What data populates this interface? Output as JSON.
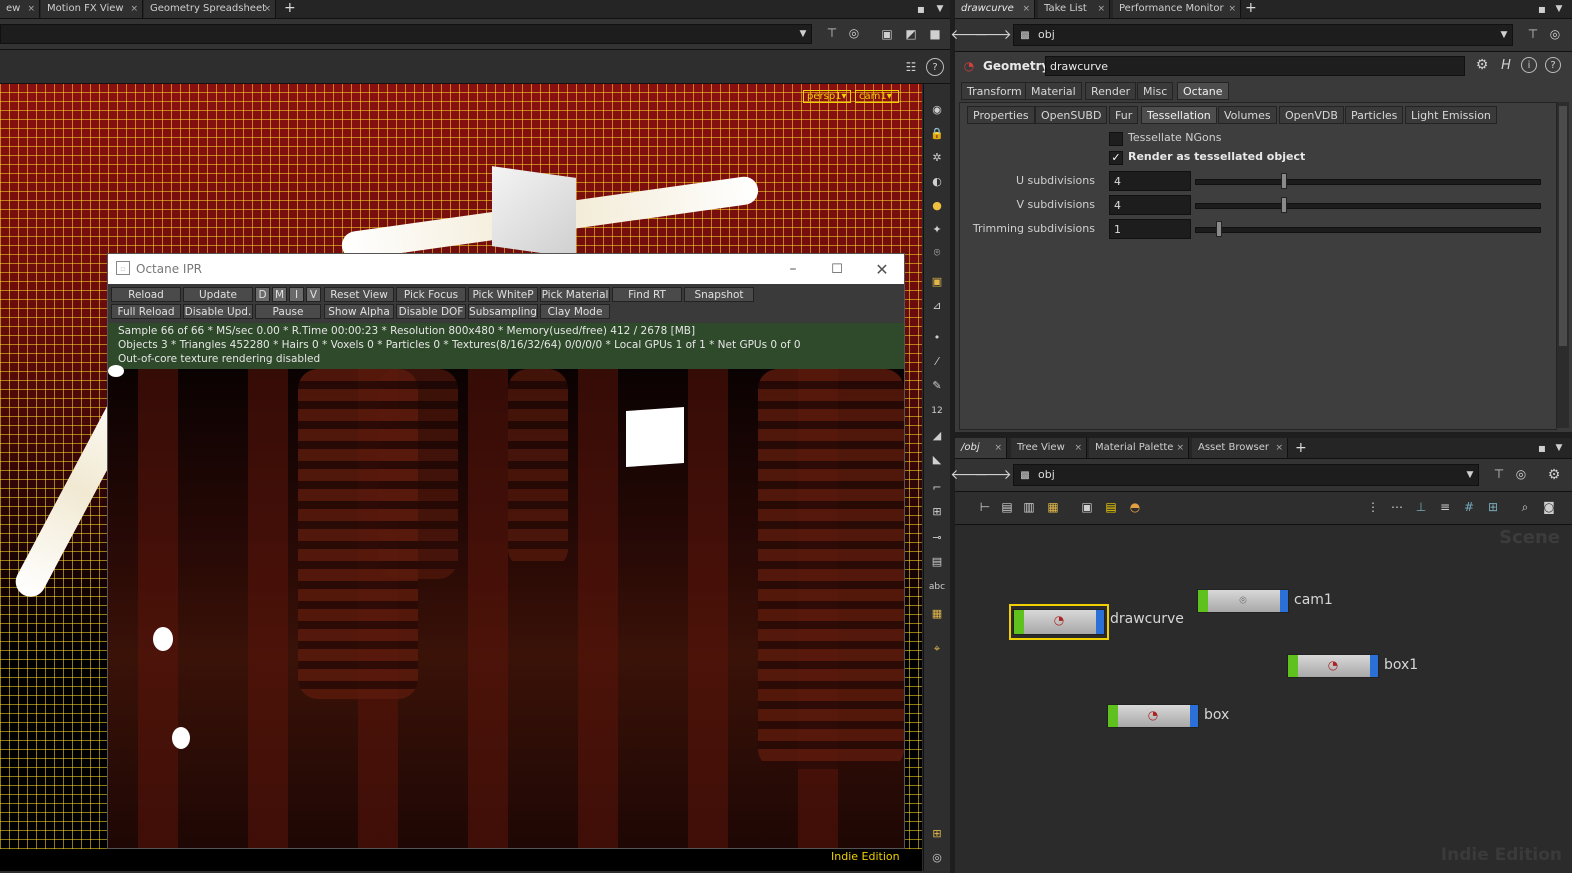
{
  "left_tabs": [
    {
      "label": "ew",
      "close": "×"
    },
    {
      "label": "Motion FX View",
      "close": "×"
    },
    {
      "label": "Geometry Spreadsheet",
      "close": "×"
    }
  ],
  "add_tab": "+",
  "viewport": {
    "camera_menu": "persp1",
    "cam_menu": "cam1",
    "edition_label": "Indie Edition"
  },
  "octane": {
    "title": "Octane IPR",
    "row1": [
      "Reload",
      "Update",
      "D",
      "M",
      "I",
      "V",
      "Reset View",
      "Pick Focus",
      "Pick WhiteP",
      "Pick Material",
      "Find RT",
      "Snapshot"
    ],
    "row2": [
      "Full Reload",
      "Disable Upd.",
      "Pause",
      "Show Alpha",
      "Disable DOF",
      "Subsampling",
      "Clay Mode"
    ],
    "status": [
      "Sample 66 of 66 * MS/sec 0.00 * R.Time 00:00:23 * Resolution 800x480 * Memory(used/free) 412 / 2678 [MB]",
      "Objects 3 * Triangles 452280 * Hairs 0 * Voxels 0 * Particles 0 * Textures(8/16/32/64) 0/0/0/0 * Local GPUs 1 of 1 * Net GPUs 0 of 0",
      "Out-of-core texture rendering disabled"
    ]
  },
  "right_tabs": [
    {
      "label": "drawcurve",
      "close": "×"
    },
    {
      "label": "Take List",
      "close": "×"
    },
    {
      "label": "Performance Monitor",
      "close": "×"
    }
  ],
  "path_top": "obj",
  "params": {
    "node_type": "Geometry",
    "node_name": "drawcurve",
    "main_tabs": [
      "Transform",
      "Material",
      "Render",
      "Misc",
      "Octane"
    ],
    "sub_tabs": [
      "Properties",
      "OpenSUBD",
      "Fur",
      "Tessellation",
      "Volumes",
      "OpenVDB",
      "Particles",
      "Light Emission"
    ],
    "tessellate_ngons": "Tessellate NGons",
    "render_tessellated": "Render as tessellated object",
    "rows": [
      {
        "label": "U subdivisions",
        "value": "4",
        "fraction": 0.25
      },
      {
        "label": "V subdivisions",
        "value": "4",
        "fraction": 0.25
      },
      {
        "label": "Trimming subdivisions",
        "value": "1",
        "fraction": 0.06
      }
    ]
  },
  "net_tabs": [
    {
      "label": "/obj",
      "close": "×"
    },
    {
      "label": "Tree View",
      "close": "×"
    },
    {
      "label": "Material Palette",
      "close": "×"
    },
    {
      "label": "Asset Browser",
      "close": "×"
    }
  ],
  "path_bottom": "obj",
  "network": {
    "watermark_scene": "Scene",
    "watermark_edition": "Indie Edition",
    "nodes": [
      {
        "name": "drawcurve",
        "selected": true
      },
      {
        "name": "cam1",
        "selected": false
      },
      {
        "name": "box1",
        "selected": false
      },
      {
        "name": "box",
        "selected": false
      }
    ]
  },
  "colors": {
    "accent_yellow": "#f0d000",
    "node_green": "#5ec11e",
    "node_blue": "#2a70d6",
    "status_green": "#2f4a2b"
  }
}
